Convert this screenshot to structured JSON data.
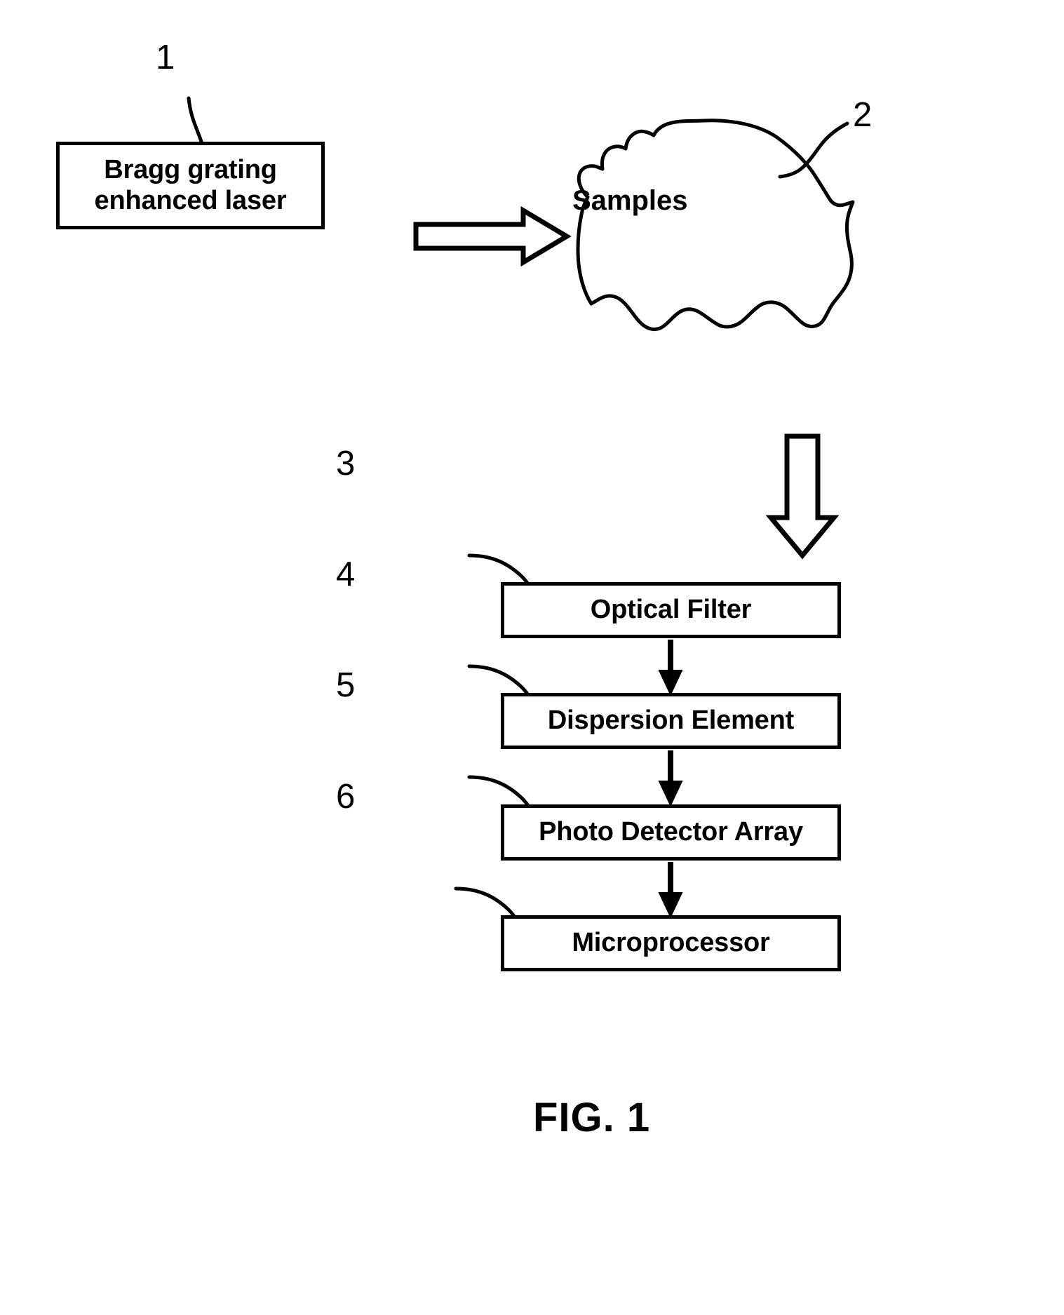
{
  "figure": {
    "caption": "FIG. 1",
    "background_color": "#ffffff",
    "line_color": "#000000"
  },
  "blob": {
    "label": "Samples",
    "reference_numeral": "2"
  },
  "nodes": [
    {
      "id": "laser",
      "label_line1": "Bragg grating",
      "label_line2": "enhanced laser",
      "reference_numeral": "1"
    },
    {
      "id": "optical-filter",
      "label": "Optical Filter",
      "reference_numeral": "3"
    },
    {
      "id": "dispersion-element",
      "label": "Dispersion Element",
      "reference_numeral": "4"
    },
    {
      "id": "photo-detector-array",
      "label": "Photo Detector Array",
      "reference_numeral": "5"
    },
    {
      "id": "microprocessor",
      "label": "Microprocessor",
      "reference_numeral": "6"
    }
  ],
  "connectors": [
    {
      "id": "laser-to-samples",
      "style": "hollow-block-arrow",
      "direction": "right"
    },
    {
      "id": "samples-to-optical-filter",
      "style": "hollow-block-arrow",
      "direction": "down"
    },
    {
      "id": "optical-filter-to-dispersion-element",
      "style": "solid-arrow",
      "direction": "down"
    },
    {
      "id": "dispersion-element-to-photo-detector-array",
      "style": "solid-arrow",
      "direction": "down"
    },
    {
      "id": "photo-detector-array-to-microprocessor",
      "style": "solid-arrow",
      "direction": "down"
    }
  ],
  "lead_lines": [
    {
      "id": "lead-1",
      "numeral": "1",
      "target": "laser"
    },
    {
      "id": "lead-2",
      "numeral": "2",
      "target": "samples"
    },
    {
      "id": "lead-3",
      "numeral": "3",
      "target": "optical-filter"
    },
    {
      "id": "lead-4",
      "numeral": "4",
      "target": "dispersion-element"
    },
    {
      "id": "lead-5",
      "numeral": "5",
      "target": "photo-detector-array"
    },
    {
      "id": "lead-6",
      "numeral": "6",
      "target": "microprocessor"
    }
  ]
}
